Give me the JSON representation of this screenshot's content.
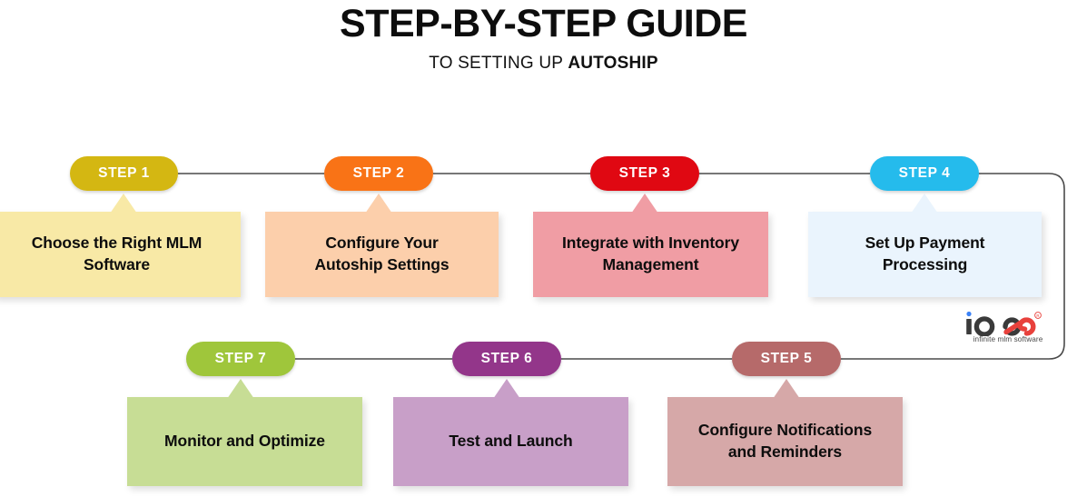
{
  "header": {
    "title": "STEP-BY-STEP GUIDE",
    "subtitle_plain": "TO SETTING UP ",
    "subtitle_bold": "AUTOSHIP"
  },
  "steps": [
    {
      "badge": "STEP 1",
      "line1": "Choose the Right MLM",
      "line2": "Software",
      "badge_color": "#d4b712",
      "card_color": "#f8e9a6",
      "pointer_color": "#f8e9a6",
      "row": "top"
    },
    {
      "badge": "STEP 2",
      "line1": "Configure Your",
      "line2": "Autoship Settings",
      "badge_color": "#f97316",
      "card_color": "#fccfab",
      "pointer_color": "#fccfab",
      "row": "top"
    },
    {
      "badge": "STEP 3",
      "line1": "Integrate with Inventory",
      "line2": "Management",
      "badge_color": "#e00812",
      "card_color": "#f09da4",
      "pointer_color": "#f09da4",
      "row": "top"
    },
    {
      "badge": "STEP 4",
      "line1": "Set Up Payment",
      "line2": "Processing",
      "badge_color": "#25bbec",
      "card_color": "#eaf4fd",
      "pointer_color": "#eaf4fd",
      "row": "top"
    },
    {
      "badge": "STEP 5",
      "line1": "Configure Notifications",
      "line2": "and Reminders",
      "badge_color": "#b66a6a",
      "card_color": "#d6a8a8",
      "pointer_color": "#d6a8a8",
      "row": "bottom"
    },
    {
      "badge": "STEP 6",
      "line1": "Test and Launch",
      "line2": "",
      "badge_color": "#93368a",
      "card_color": "#c89fc8",
      "pointer_color": "#c89fc8",
      "row": "bottom"
    },
    {
      "badge": "STEP 7",
      "line1": "Monitor and Optimize",
      "line2": "",
      "badge_color": "#9dc council",
      "card_color": "#c7dd95",
      "pointer_color": "#c7dd95",
      "row": "bottom"
    }
  ],
  "logo": {
    "name": "infinite-mlm-logo",
    "wordmark": "io",
    "tagline": "infinite mlm software",
    "registered_mark": "®",
    "dot_color": "#3b82f6",
    "dark_color": "#3a3a3a",
    "accent_color": "#e8413c"
  },
  "colors": {
    "connector_line": "#4a4a4a",
    "background": "#ffffff",
    "text": "#0d0d0d"
  }
}
